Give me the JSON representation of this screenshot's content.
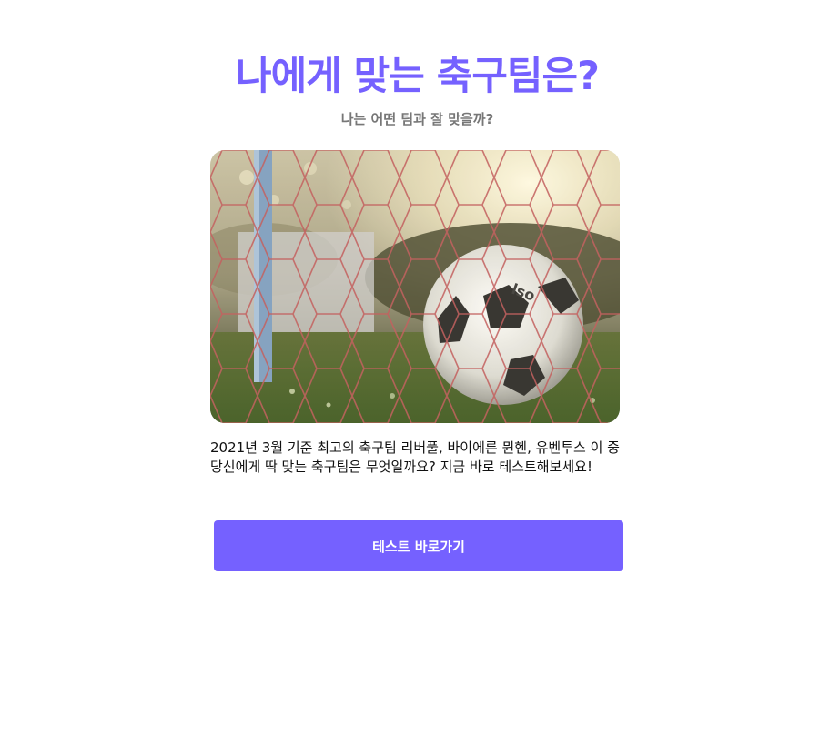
{
  "page": {
    "title": "나에게 맞는 축구팀은?",
    "subtitle": "나는 어떤 팀과 잘 맞을까?",
    "hero_image": {
      "subject": "soccer ball resting in goal net on grass at sunset"
    },
    "description": "2021년 3월 기준 최고의 축구팀 리버풀, 바이에른 뮌헨, 유벤투스 이 중 당신에게 딱 맞는 축구팀은 무엇일까요? 지금 바로 테스트해보세요!",
    "cta_label": "테스트 바로가기"
  },
  "colors": {
    "accent": "#7561ff",
    "subtitle": "#777777",
    "text": "#111111",
    "background": "#ffffff"
  }
}
